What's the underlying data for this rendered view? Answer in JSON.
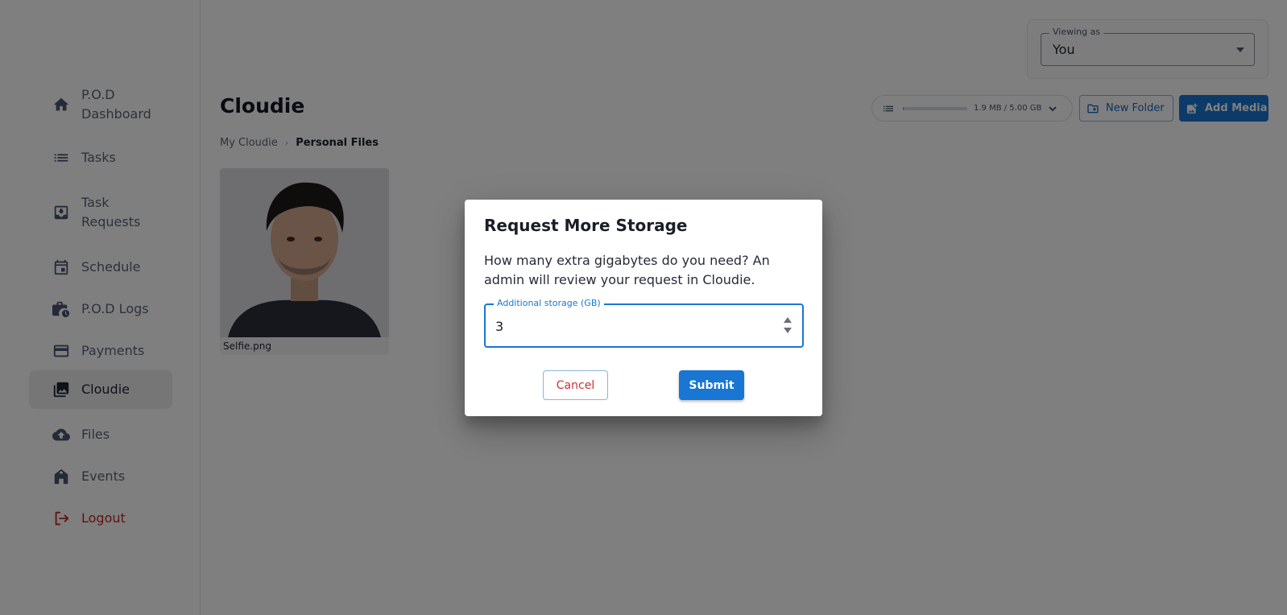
{
  "sidebar": {
    "items": [
      {
        "label": "P.O.D Dashboard",
        "icon": "home-icon"
      },
      {
        "label": "Tasks",
        "icon": "list-icon"
      },
      {
        "label": "Task Requests",
        "icon": "inbox-download-icon"
      },
      {
        "label": "Schedule",
        "icon": "calendar-icon"
      },
      {
        "label": "P.O.D Logs",
        "icon": "work-history-icon"
      },
      {
        "label": "Payments",
        "icon": "credit-card-icon"
      },
      {
        "label": "Cloudie",
        "icon": "photo-library-icon",
        "active": true
      },
      {
        "label": "Files",
        "icon": "cloud-upload-icon"
      },
      {
        "label": "Events",
        "icon": "house-event-icon"
      },
      {
        "label": "Logout",
        "icon": "logout-icon"
      }
    ]
  },
  "viewing_as": {
    "label": "Viewing as",
    "value": "You"
  },
  "header": {
    "title": "Cloudie"
  },
  "breadcrumb": {
    "root": "My Cloudie",
    "current": "Personal Files"
  },
  "storage": {
    "text": "1.9 MB / 5.00 GB",
    "used_fraction": 0.0004
  },
  "toolbar": {
    "new_folder_label": "New Folder",
    "add_media_label": "Add Media"
  },
  "media": [
    {
      "name": "Selfie.png"
    }
  ],
  "dialog": {
    "title": "Request More Storage",
    "text": "How many extra gigabytes do you need? An admin will review your request in Cloudie.",
    "field_label": "Additional storage (GB)",
    "field_value": "3",
    "cancel_label": "Cancel",
    "submit_label": "Submit"
  },
  "colors": {
    "primary": "#1976d2",
    "danger": "#d32f2f",
    "logout": "#c2271d"
  }
}
